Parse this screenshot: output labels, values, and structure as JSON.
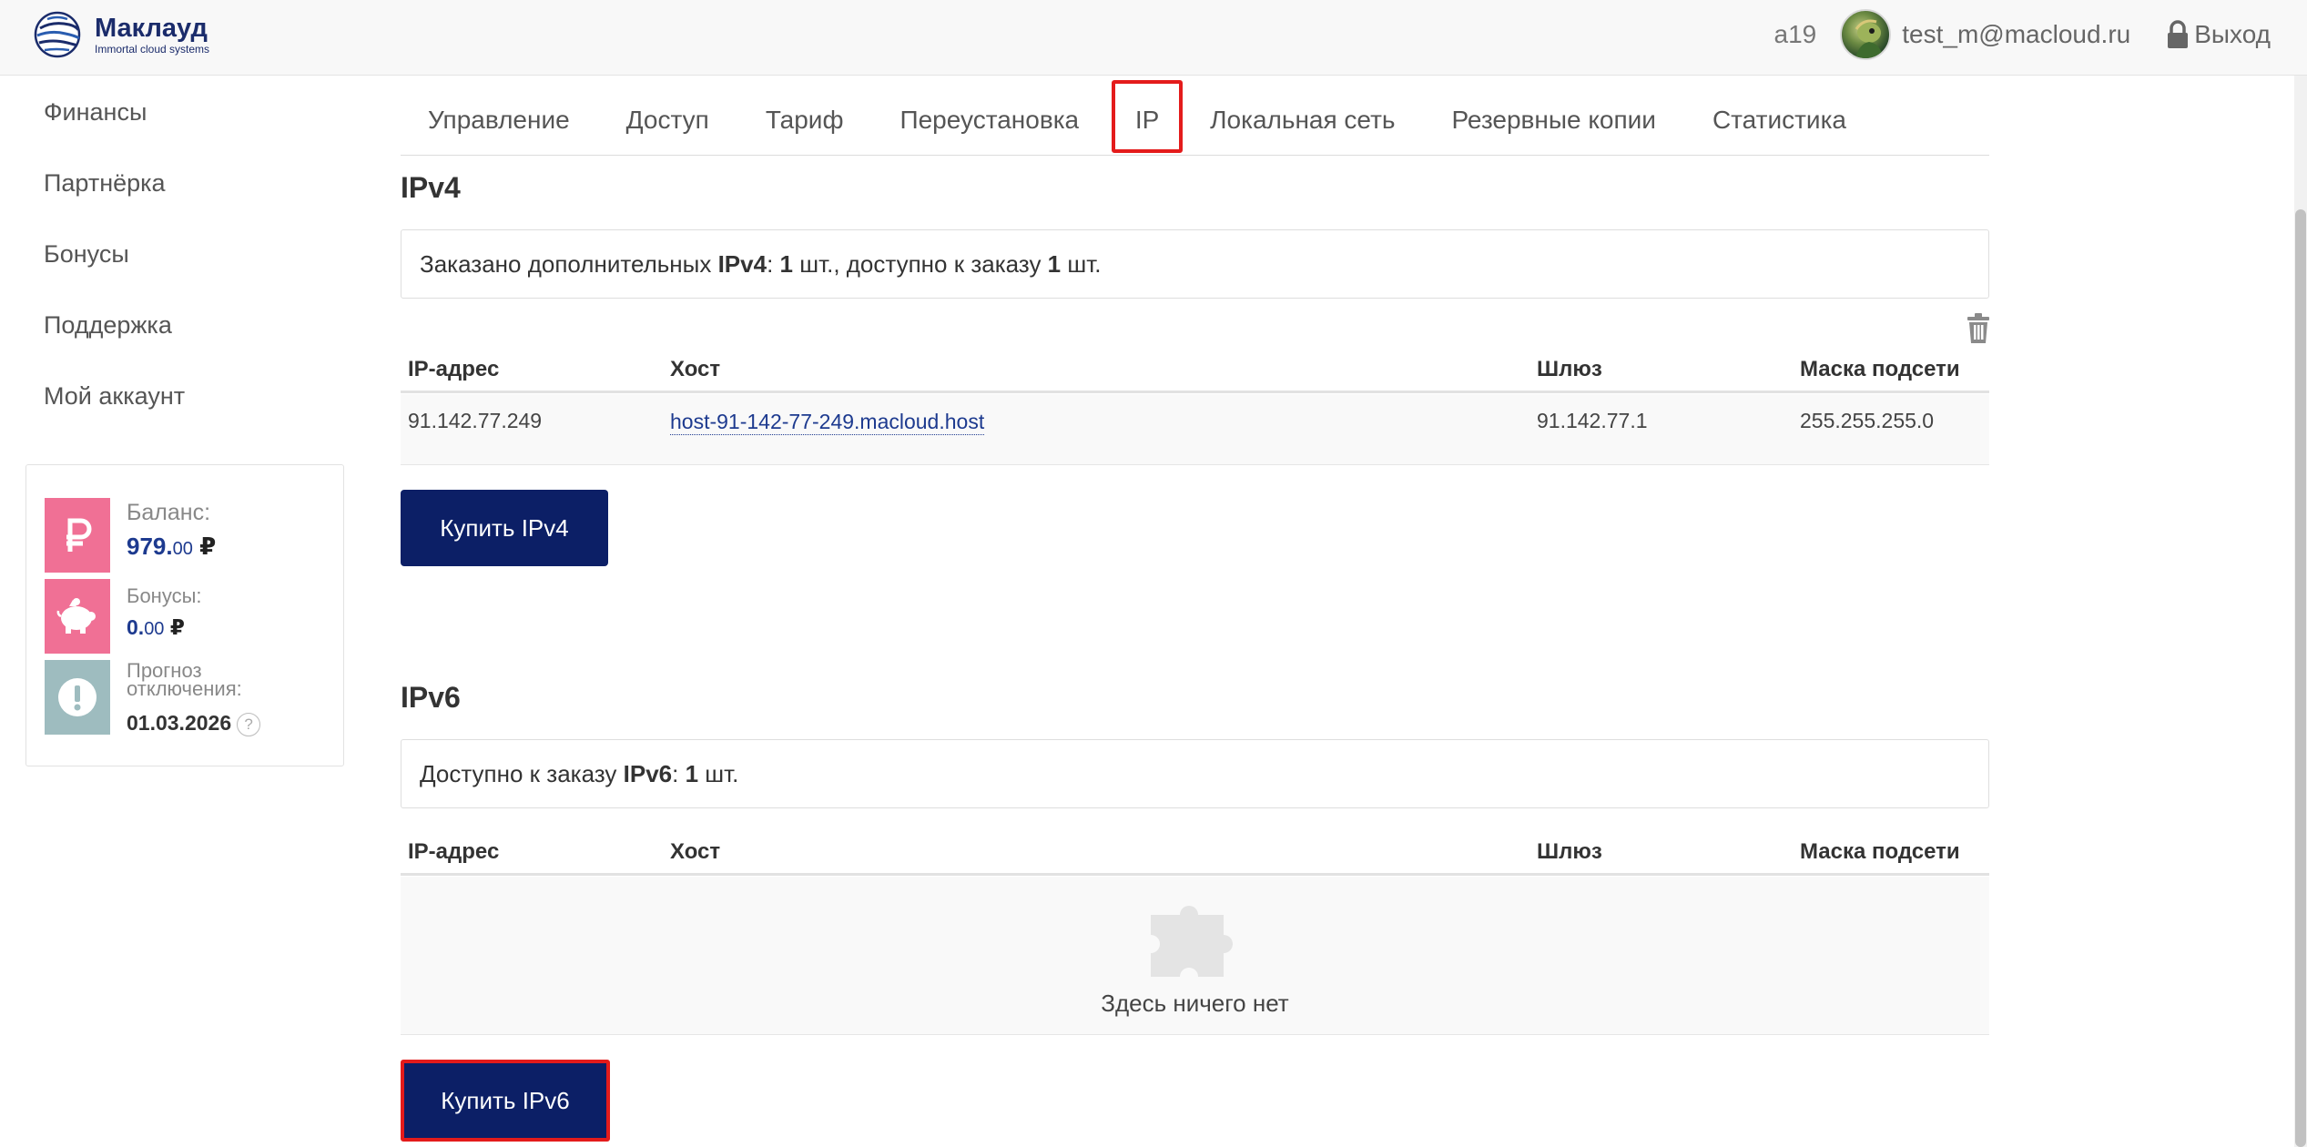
{
  "header": {
    "logo_name": "Маклауд",
    "logo_sub": "Immortal cloud systems",
    "version": "a19",
    "email": "test_m@macloud.ru",
    "logout": "Выход"
  },
  "sidebar": {
    "items": [
      {
        "label": "Финансы"
      },
      {
        "label": "Партнёрка"
      },
      {
        "label": "Бонусы"
      },
      {
        "label": "Поддержка"
      },
      {
        "label": "Мой аккаунт"
      }
    ],
    "balance": {
      "balance_label": "Баланс:",
      "balance_int": "979.",
      "balance_cents": "00",
      "balance_currency": "₽",
      "bonus_label": "Бонусы:",
      "bonus_int": "0.",
      "bonus_cents": "00",
      "bonus_currency": "₽",
      "forecast_label_1": "Прогноз",
      "forecast_label_2": "отключения:",
      "forecast_date": "01.03.2026",
      "help": "?"
    }
  },
  "tabs": [
    {
      "label": "Управление"
    },
    {
      "label": "Доступ"
    },
    {
      "label": "Тариф"
    },
    {
      "label": "Переустановка"
    },
    {
      "label": "IP"
    },
    {
      "label": "Локальная сеть"
    },
    {
      "label": "Резервные копии"
    },
    {
      "label": "Статистика"
    }
  ],
  "ipv4": {
    "title": "IPv4",
    "info_prefix": "Заказано дополнительных ",
    "info_kind": "IPv4",
    "info_colon": ": ",
    "info_ordered": "1",
    "info_mid": " шт., доступно к заказу ",
    "info_available": "1",
    "info_suffix": " шт.",
    "columns": [
      "IP-адрес",
      "Хост",
      "Шлюз",
      "Маска подсети"
    ],
    "rows": [
      {
        "ip": "91.142.77.249",
        "host": "host-91-142-77-249.macloud.host",
        "gateway": "91.142.77.1",
        "mask": "255.255.255.0"
      }
    ],
    "buy_button": "Купить IPv4"
  },
  "ipv6": {
    "title": "IPv6",
    "info_prefix": "Доступно к заказу ",
    "info_kind": "IPv6",
    "info_colon": ": ",
    "info_available": "1",
    "info_suffix": " шт.",
    "columns": [
      "IP-адрес",
      "Хост",
      "Шлюз",
      "Маска подсети"
    ],
    "empty_text": "Здесь ничего нет",
    "buy_button": "Купить IPv6"
  },
  "colors": {
    "brand_navy": "#0c1f66",
    "highlight_red": "#e41b1b",
    "icon_pink": "#f07095",
    "icon_grey": "#9ebcbf",
    "balance_blue": "#1d3a8f"
  },
  "icons": {
    "logo": "globe-logo-icon",
    "lock": "lock-icon",
    "ruble": "ruble-icon",
    "piggy": "piggy-bank-icon",
    "alert": "exclamation-icon",
    "trash": "trash-icon",
    "empty": "puzzle-piece-icon"
  }
}
